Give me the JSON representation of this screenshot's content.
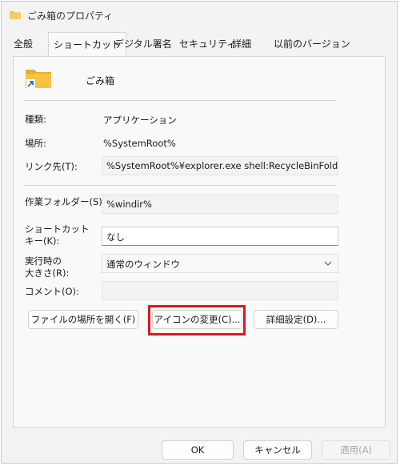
{
  "window": {
    "title": "ごみ箱のプロパティ"
  },
  "tabs": [
    {
      "label": "全般"
    },
    {
      "label": "ショートカット"
    },
    {
      "label": "デジタル署名"
    },
    {
      "label": "セキュリティ"
    },
    {
      "label": "詳細"
    },
    {
      "label": "以前のバージョン"
    }
  ],
  "header": {
    "name": "ごみ箱"
  },
  "props": {
    "type_label": "種類:",
    "type_value": "アプリケーション",
    "location_label": "場所:",
    "location_value": "%SystemRoot%",
    "target_label": "リンク先(T):",
    "target_value": "%SystemRoot%¥explorer.exe shell:RecycleBinFolder",
    "workdir_label": "作業フォルダー(S):",
    "workdir_value": "%windir%",
    "shortcut_label_1": "ショートカット",
    "shortcut_label_2": "キー(K):",
    "shortcut_value": "なし",
    "run_label_1": "実行時の",
    "run_label_2": "大きさ(R):",
    "run_value": "通常のウィンドウ",
    "comment_label": "コメント(O):",
    "comment_value": ""
  },
  "buttons": {
    "open_location": "ファイルの場所を開く(F)",
    "change_icon": "アイコンの変更(C)...",
    "advanced": "詳細設定(D)..."
  },
  "footer": {
    "ok": "OK",
    "cancel": "キャンセル",
    "apply": "適用(A)"
  },
  "colors": {
    "highlight": "#e0161e",
    "folder": "#f5c242",
    "shortcut_arrow": "#1f6fd6"
  },
  "icons": {
    "title": "recycle-bin-folder-icon",
    "header": "recycle-bin-shortcut-icon",
    "dropdown": "chevron-down-icon"
  }
}
